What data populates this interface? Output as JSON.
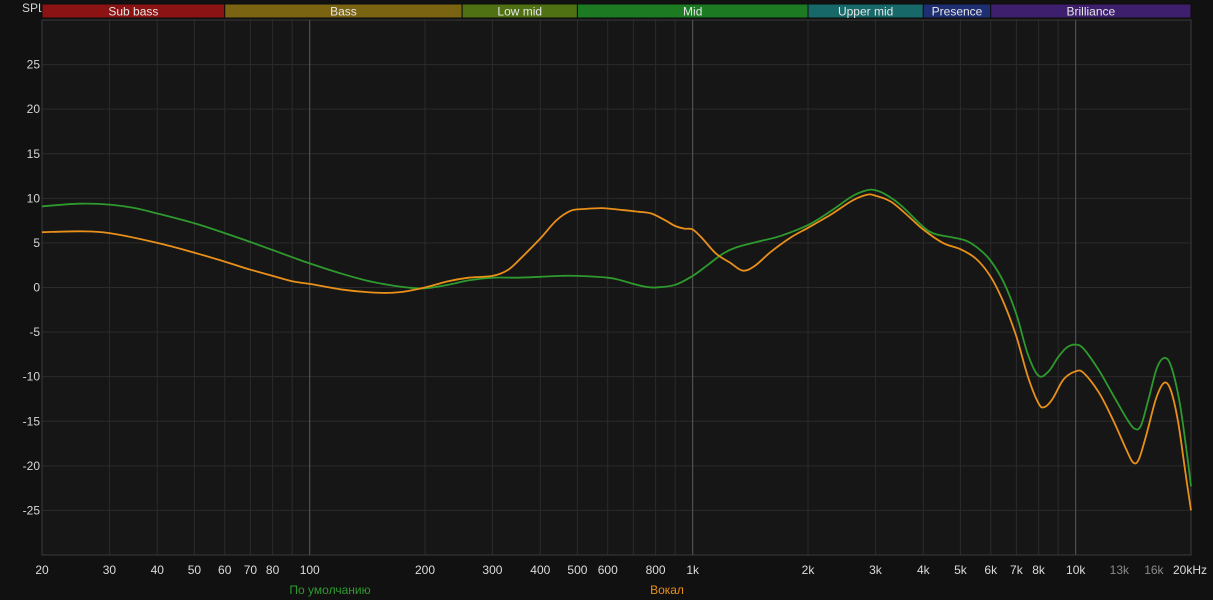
{
  "chart_data": {
    "type": "line",
    "ylabel": "SPL",
    "xscale": "log",
    "xlim": [
      20,
      20000
    ],
    "ylim": [
      -30,
      30
    ],
    "grid": true,
    "bands": [
      {
        "label": "Sub bass",
        "from": 20,
        "to": 60,
        "color": "#8b1313"
      },
      {
        "label": "Bass",
        "from": 60,
        "to": 250,
        "color": "#7a6412"
      },
      {
        "label": "Low mid",
        "from": 250,
        "to": 500,
        "color": "#4f7113"
      },
      {
        "label": "Mid",
        "from": 500,
        "to": 2000,
        "color": "#1c7a23"
      },
      {
        "label": "Upper mid",
        "from": 2000,
        "to": 4000,
        "color": "#176868"
      },
      {
        "label": "Presence",
        "from": 4000,
        "to": 6000,
        "color": "#1e2e72"
      },
      {
        "label": "Brilliance",
        "from": 6000,
        "to": 20000,
        "color": "#3e1f6e"
      }
    ],
    "x_ticks": [
      {
        "v": 20,
        "label": "20"
      },
      {
        "v": 30,
        "label": "30"
      },
      {
        "v": 40,
        "label": "40"
      },
      {
        "v": 50,
        "label": "50"
      },
      {
        "v": 60,
        "label": "60"
      },
      {
        "v": 70,
        "label": "70"
      },
      {
        "v": 80,
        "label": "80"
      },
      {
        "v": 100,
        "label": "100"
      },
      {
        "v": 200,
        "label": "200"
      },
      {
        "v": 300,
        "label": "300"
      },
      {
        "v": 400,
        "label": "400"
      },
      {
        "v": 500,
        "label": "500"
      },
      {
        "v": 600,
        "label": "600"
      },
      {
        "v": 800,
        "label": "800"
      },
      {
        "v": 1000,
        "label": "1k"
      },
      {
        "v": 2000,
        "label": "2k"
      },
      {
        "v": 3000,
        "label": "3k"
      },
      {
        "v": 4000,
        "label": "4k"
      },
      {
        "v": 5000,
        "label": "5k"
      },
      {
        "v": 6000,
        "label": "6k"
      },
      {
        "v": 7000,
        "label": "7k"
      },
      {
        "v": 8000,
        "label": "8k"
      },
      {
        "v": 10000,
        "label": "10k"
      },
      {
        "v": 13000,
        "label": "13k",
        "muted": true
      },
      {
        "v": 16000,
        "label": "16k",
        "muted": true
      },
      {
        "v": 20000,
        "label": "20kHz"
      }
    ],
    "x_grid": [
      20,
      30,
      40,
      50,
      60,
      70,
      80,
      90,
      100,
      200,
      300,
      400,
      500,
      600,
      700,
      800,
      900,
      1000,
      2000,
      3000,
      4000,
      5000,
      6000,
      7000,
      8000,
      9000,
      10000,
      20000
    ],
    "x_major": [
      100,
      1000,
      10000
    ],
    "y_ticks": [
      -25,
      -20,
      -15,
      -10,
      -5,
      0,
      5,
      10,
      15,
      20,
      25
    ],
    "y_grid": [
      -30,
      -25,
      -20,
      -15,
      -10,
      -5,
      0,
      5,
      10,
      15,
      20,
      25,
      30
    ],
    "series": [
      {
        "name": "По умолчанию",
        "color": "#2e9a2e",
        "points": [
          [
            20,
            9.1
          ],
          [
            25,
            9.4
          ],
          [
            30,
            9.3
          ],
          [
            35,
            8.9
          ],
          [
            40,
            8.3
          ],
          [
            50,
            7.2
          ],
          [
            60,
            6.1
          ],
          [
            70,
            5.1
          ],
          [
            80,
            4.2
          ],
          [
            90,
            3.4
          ],
          [
            100,
            2.7
          ],
          [
            120,
            1.6
          ],
          [
            140,
            0.8
          ],
          [
            160,
            0.3
          ],
          [
            180,
            0.0
          ],
          [
            200,
            -0.1
          ],
          [
            230,
            0.3
          ],
          [
            260,
            0.8
          ],
          [
            300,
            1.1
          ],
          [
            350,
            1.1
          ],
          [
            400,
            1.2
          ],
          [
            450,
            1.3
          ],
          [
            500,
            1.3
          ],
          [
            600,
            1.1
          ],
          [
            650,
            0.8
          ],
          [
            700,
            0.4
          ],
          [
            750,
            0.1
          ],
          [
            800,
            0.0
          ],
          [
            900,
            0.3
          ],
          [
            1000,
            1.3
          ],
          [
            1100,
            2.6
          ],
          [
            1200,
            3.8
          ],
          [
            1300,
            4.5
          ],
          [
            1500,
            5.2
          ],
          [
            1700,
            5.8
          ],
          [
            2000,
            7.0
          ],
          [
            2300,
            8.6
          ],
          [
            2600,
            10.2
          ],
          [
            2850,
            10.9
          ],
          [
            3000,
            10.9
          ],
          [
            3200,
            10.4
          ],
          [
            3500,
            9.2
          ],
          [
            4000,
            6.8
          ],
          [
            4300,
            6.0
          ],
          [
            4800,
            5.6
          ],
          [
            5200,
            5.2
          ],
          [
            5600,
            4.3
          ],
          [
            6000,
            3.0
          ],
          [
            6500,
            0.5
          ],
          [
            7000,
            -3.0
          ],
          [
            7500,
            -7.5
          ],
          [
            8000,
            -9.9
          ],
          [
            8500,
            -9.4
          ],
          [
            9000,
            -7.8
          ],
          [
            9500,
            -6.7
          ],
          [
            10000,
            -6.4
          ],
          [
            10500,
            -6.9
          ],
          [
            11500,
            -9.3
          ],
          [
            12500,
            -12.0
          ],
          [
            13500,
            -14.5
          ],
          [
            14200,
            -15.8
          ],
          [
            14800,
            -15.5
          ],
          [
            15500,
            -12.5
          ],
          [
            16300,
            -9.0
          ],
          [
            17100,
            -7.9
          ],
          [
            17800,
            -9.0
          ],
          [
            18700,
            -13.0
          ],
          [
            19500,
            -18.5
          ],
          [
            20000,
            -22.3
          ]
        ]
      },
      {
        "name": "Вокал",
        "color": "#e8901a",
        "points": [
          [
            20,
            6.2
          ],
          [
            25,
            6.3
          ],
          [
            30,
            6.1
          ],
          [
            40,
            5.0
          ],
          [
            50,
            3.9
          ],
          [
            60,
            2.9
          ],
          [
            70,
            2.0
          ],
          [
            80,
            1.3
          ],
          [
            90,
            0.7
          ],
          [
            100,
            0.4
          ],
          [
            120,
            -0.2
          ],
          [
            140,
            -0.5
          ],
          [
            160,
            -0.6
          ],
          [
            180,
            -0.4
          ],
          [
            200,
            0.0
          ],
          [
            230,
            0.7
          ],
          [
            260,
            1.1
          ],
          [
            300,
            1.3
          ],
          [
            330,
            2.0
          ],
          [
            360,
            3.5
          ],
          [
            400,
            5.5
          ],
          [
            440,
            7.5
          ],
          [
            480,
            8.6
          ],
          [
            520,
            8.8
          ],
          [
            580,
            8.9
          ],
          [
            650,
            8.7
          ],
          [
            720,
            8.5
          ],
          [
            780,
            8.3
          ],
          [
            850,
            7.5
          ],
          [
            900,
            6.9
          ],
          [
            950,
            6.6
          ],
          [
            1000,
            6.5
          ],
          [
            1060,
            5.5
          ],
          [
            1150,
            3.8
          ],
          [
            1250,
            2.8
          ],
          [
            1350,
            1.9
          ],
          [
            1450,
            2.4
          ],
          [
            1600,
            4.0
          ],
          [
            1800,
            5.6
          ],
          [
            2000,
            6.7
          ],
          [
            2300,
            8.2
          ],
          [
            2600,
            9.7
          ],
          [
            2850,
            10.4
          ],
          [
            3000,
            10.3
          ],
          [
            3300,
            9.6
          ],
          [
            3700,
            7.8
          ],
          [
            4000,
            6.5
          ],
          [
            4500,
            5.0
          ],
          [
            5000,
            4.3
          ],
          [
            5500,
            3.2
          ],
          [
            6000,
            1.2
          ],
          [
            6500,
            -1.8
          ],
          [
            7000,
            -5.5
          ],
          [
            7500,
            -10.0
          ],
          [
            8000,
            -13.0
          ],
          [
            8300,
            -13.4
          ],
          [
            8700,
            -12.5
          ],
          [
            9300,
            -10.3
          ],
          [
            10000,
            -9.4
          ],
          [
            10500,
            -9.6
          ],
          [
            11500,
            -11.8
          ],
          [
            12500,
            -14.8
          ],
          [
            13500,
            -18.0
          ],
          [
            14100,
            -19.6
          ],
          [
            14600,
            -19.3
          ],
          [
            15300,
            -16.5
          ],
          [
            16200,
            -12.5
          ],
          [
            17000,
            -10.7
          ],
          [
            17700,
            -11.5
          ],
          [
            18500,
            -15.0
          ],
          [
            19300,
            -20.5
          ],
          [
            20000,
            -25.0
          ]
        ]
      }
    ]
  }
}
